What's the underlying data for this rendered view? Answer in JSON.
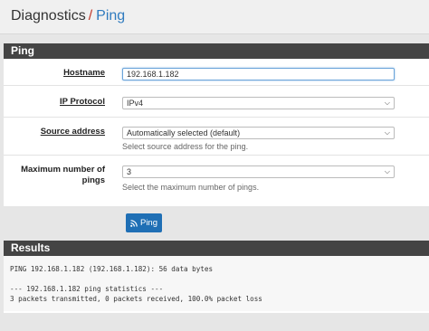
{
  "breadcrumb": {
    "parent": "Diagnostics",
    "separator": "/",
    "current": "Ping"
  },
  "ping_panel": {
    "title": "Ping",
    "hostname": {
      "label": "Hostname",
      "value": "192.168.1.182"
    },
    "ip_protocol": {
      "label": "IP Protocol",
      "value": "IPv4"
    },
    "source_address": {
      "label": "Source address",
      "value": "Automatically selected (default)",
      "help": "Select source address for the ping."
    },
    "max_pings": {
      "label_line1": "Maximum number of",
      "label_line2": "pings",
      "value": "3",
      "help": "Select the maximum number of pings."
    },
    "button_label": "Ping"
  },
  "results_panel": {
    "title": "Results",
    "lines": [
      "PING 192.168.1.182 (192.168.1.182): 56 data bytes",
      "",
      "--- 192.168.1.182 ping statistics ---",
      "3 packets transmitted, 0 packets received, 100.0% packet loss"
    ]
  }
}
